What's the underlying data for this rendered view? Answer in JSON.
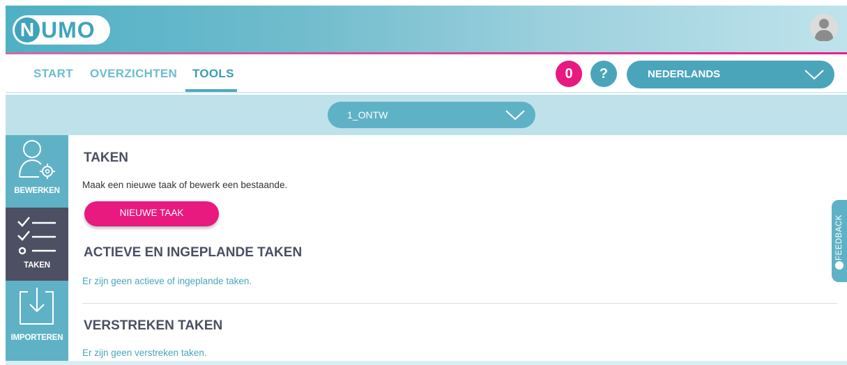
{
  "app": {
    "logo_first": "N",
    "logo_rest": "UMO"
  },
  "nav": {
    "tabs": [
      {
        "label": "START"
      },
      {
        "label": "OVERZICHTEN"
      },
      {
        "label": "TOOLS",
        "active": true
      }
    ],
    "notification_count": "0",
    "help_label": "?",
    "language": "NEDERLANDS"
  },
  "project": {
    "selected": "1_ONTW"
  },
  "sidebar": {
    "items": [
      {
        "label": "BEWERKEN",
        "icon": "user-gear-icon"
      },
      {
        "label": "TAKEN",
        "icon": "checklist-icon",
        "active": true
      },
      {
        "label": "IMPORTEREN",
        "icon": "import-icon"
      }
    ]
  },
  "main": {
    "title": "TAKEN",
    "description": "Maak een nieuwe taak of bewerk een bestaande.",
    "new_button": "NIEUWE TAAK",
    "active_section": {
      "title": "ACTIEVE EN INGEPLANDE TAKEN",
      "empty": "Er zijn geen actieve of ingeplande taken."
    },
    "expired_section": {
      "title": "VERSTREKEN TAKEN",
      "empty": "Er zijn geen verstreken taken."
    }
  },
  "feedback": {
    "label": "FEEDBACK"
  },
  "colors": {
    "accent_pink": "#e8197f",
    "accent_teal": "#4aa5bb",
    "sidebar_active": "#4d4f63"
  }
}
